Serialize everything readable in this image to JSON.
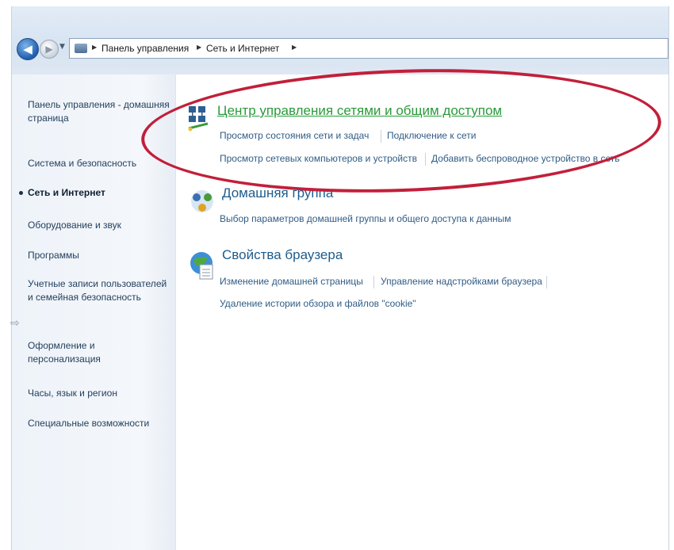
{
  "address_bar": {
    "breadcrumbs": [
      "Панель управления",
      "Сеть и Интернет"
    ]
  },
  "left_nav": {
    "items": [
      {
        "label": "Панель управления - домашняя страница",
        "active": false
      },
      {
        "label": "Система и безопасность",
        "active": false
      },
      {
        "label": "Сеть и Интернет",
        "active": true
      },
      {
        "label": "Оборудование и звук",
        "active": false
      },
      {
        "label": "Программы",
        "active": false
      },
      {
        "label": "Учетные записи пользователей и семейная безопасность",
        "active": false
      },
      {
        "label": "Оформление и персонализация",
        "active": false
      },
      {
        "label": "Часы, язык и регион",
        "active": false
      },
      {
        "label": "Специальные возможности",
        "active": false
      }
    ]
  },
  "categories": [
    {
      "title": "Центр управления сетями и общим доступом",
      "highlighted": true,
      "tasks": [
        "Просмотр состояния сети и задач",
        "Подключение к сети",
        "Просмотр сетевых компьютеров и устройств",
        "Добавить беспроводное устройство в сеть"
      ]
    },
    {
      "title": "Домашняя группа",
      "highlighted": false,
      "tasks": [
        "Выбор параметров домашней группы и общего доступа к данным"
      ]
    },
    {
      "title": "Свойства браузера",
      "highlighted": false,
      "tasks": [
        "Изменение домашней страницы",
        "Управление надстройками браузера",
        "Удаление истории обзора и файлов \"cookie\""
      ]
    }
  ],
  "colors": {
    "link": "#2f5c86",
    "highlight_title": "#2a9a3a",
    "annotation_oval": "#c21f3a"
  }
}
